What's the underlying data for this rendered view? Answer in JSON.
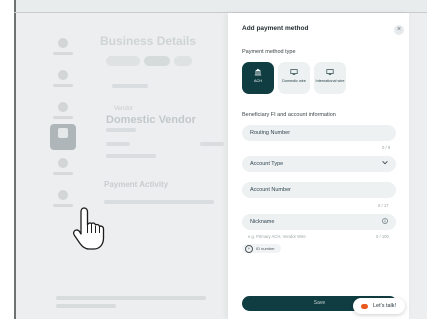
{
  "background": {
    "page_title": "Business Details",
    "vendor_label": "Vendor",
    "vendor_name": "Domestic Vendor",
    "activity_title": "Payment Activity"
  },
  "drawer": {
    "title": "Add payment method",
    "payment_method_type_label": "Payment method type",
    "payment_methods": [
      {
        "label": "ACH",
        "icon": "bank-icon",
        "selected": true
      },
      {
        "label": "Domestic wire",
        "icon": "wire-icon",
        "selected": false
      },
      {
        "label": "International wire",
        "icon": "wire-icon",
        "selected": false
      }
    ],
    "beneficiary_label": "Beneficiary FI and account information",
    "routing_number": {
      "placeholder": "Routing Number",
      "counter": "0 / 9"
    },
    "account_type": {
      "value": "Account Type"
    },
    "account_number": {
      "placeholder": "Account Number",
      "counter": "0 / 17"
    },
    "nickname": {
      "placeholder": "Nickname",
      "hint": "e.g. Primary ACH, Vendor Wire",
      "counter": "0 / 100"
    },
    "id_number_label": "ID number",
    "save_label": "Save"
  },
  "chat": {
    "label": "Let's talk!"
  },
  "colors": {
    "accent": "#0f3d42",
    "chat_icon": "#e8581f"
  }
}
